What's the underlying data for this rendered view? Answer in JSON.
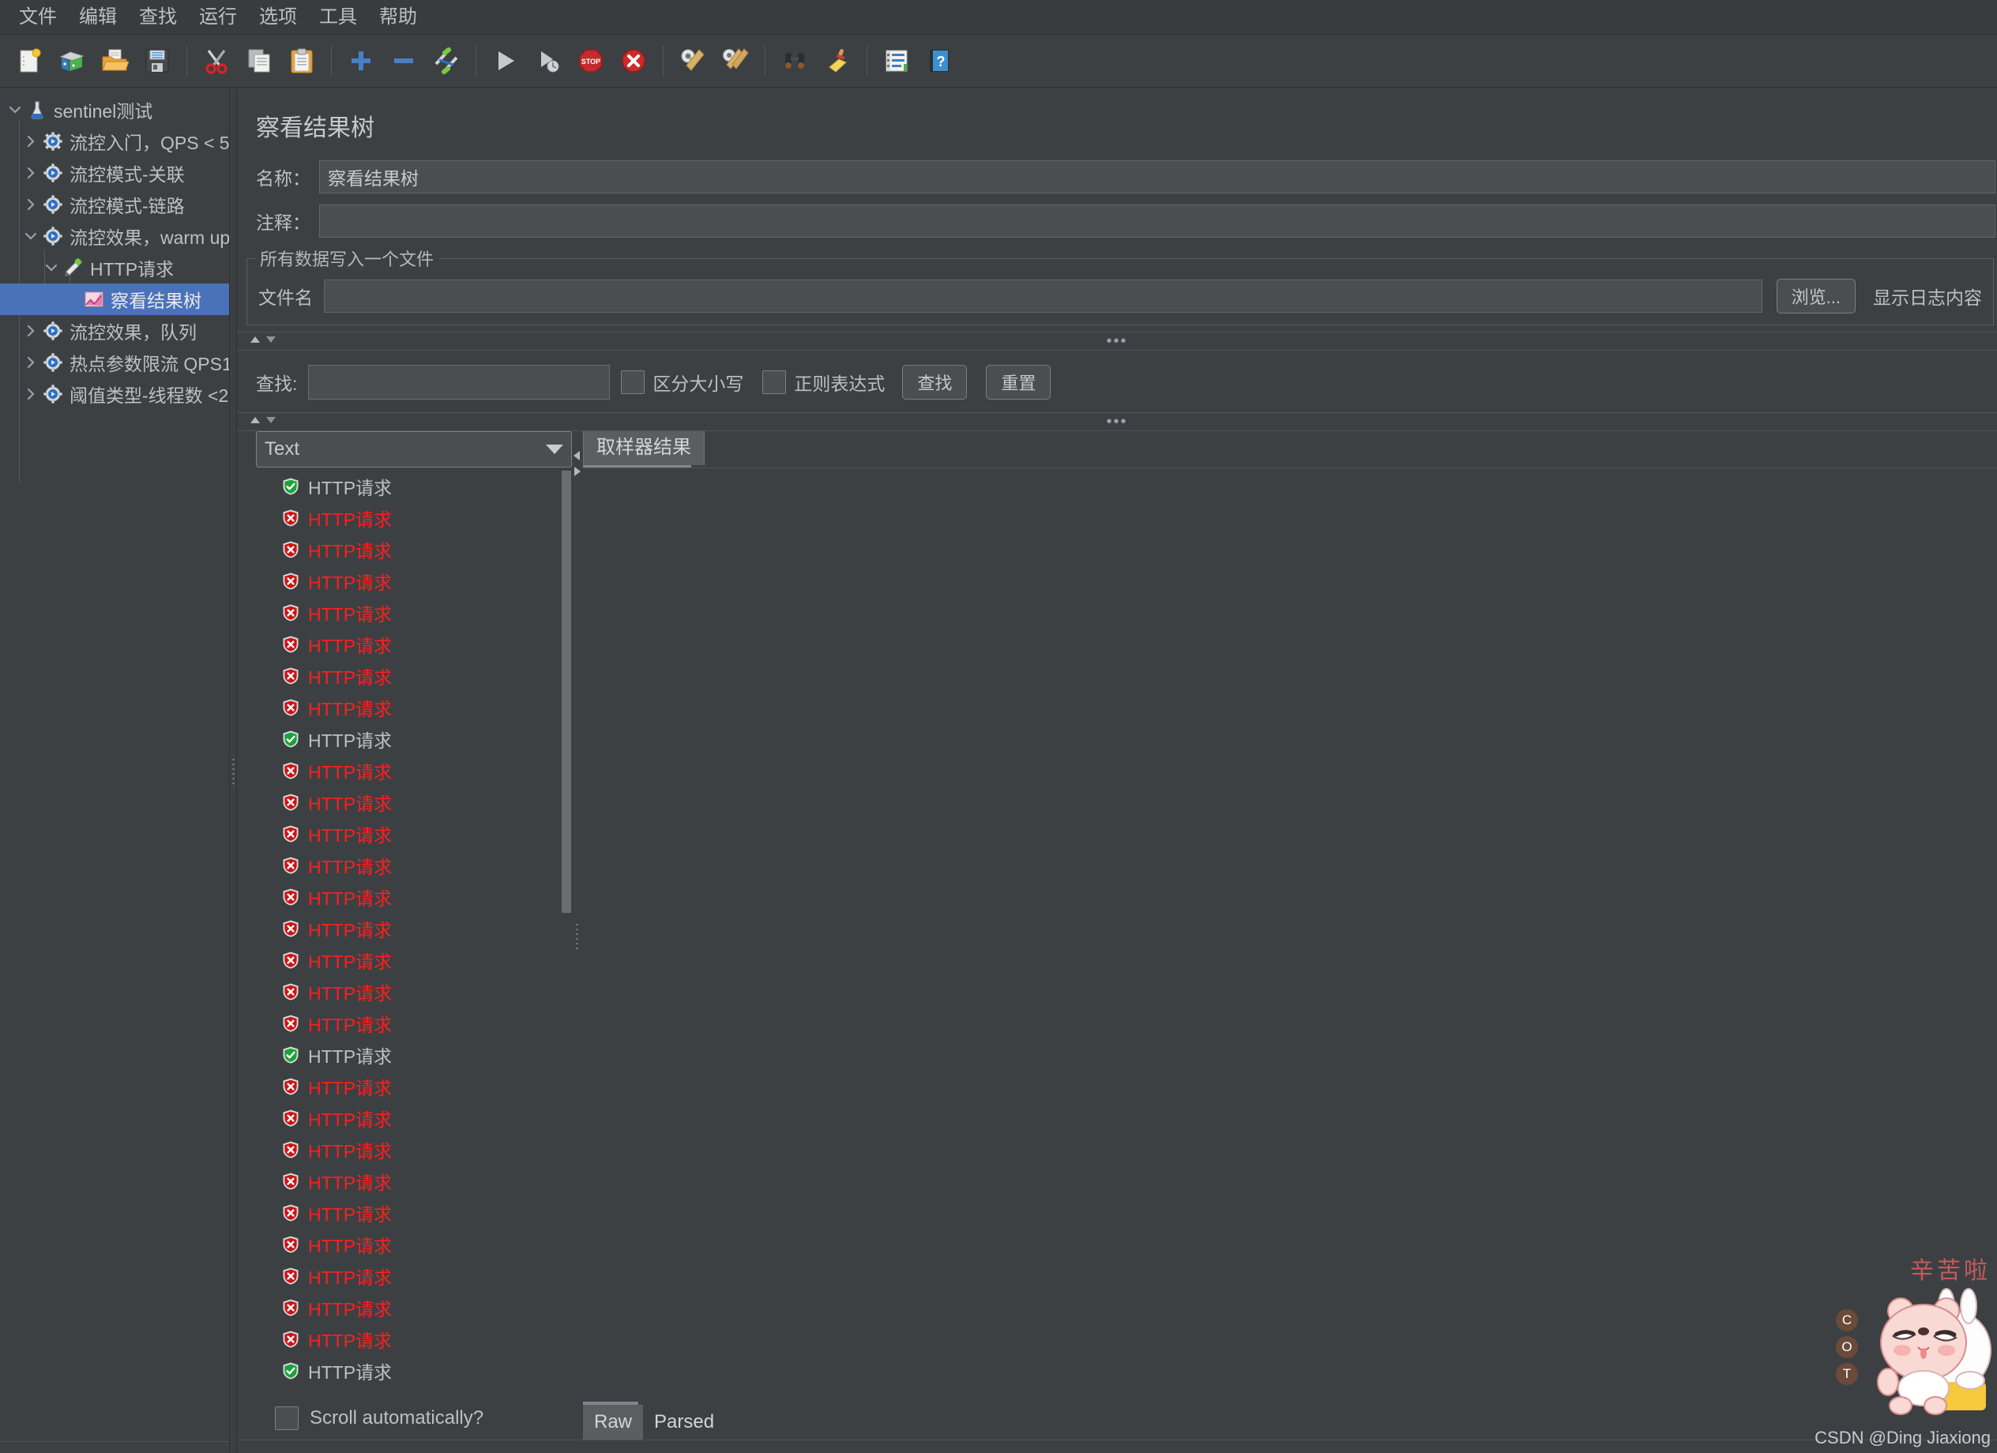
{
  "menubar": {
    "items": [
      {
        "label": "文件",
        "name": "menu-file"
      },
      {
        "label": "编辑",
        "name": "menu-edit"
      },
      {
        "label": "查找",
        "name": "menu-search"
      },
      {
        "label": "运行",
        "name": "menu-run"
      },
      {
        "label": "选项",
        "name": "menu-options"
      },
      {
        "label": "工具",
        "name": "menu-tools"
      },
      {
        "label": "帮助",
        "name": "menu-help"
      }
    ]
  },
  "toolbar": {
    "buttons": [
      {
        "icon": "new-document-icon",
        "title": "新建"
      },
      {
        "icon": "templates-icon",
        "title": "模板"
      },
      {
        "icon": "open-folder-icon",
        "title": "打开"
      },
      {
        "icon": "save-floppy-icon",
        "title": "保存"
      },
      {
        "sep": true
      },
      {
        "icon": "cut-scissors-icon",
        "title": "剪切"
      },
      {
        "icon": "copy-pages-icon",
        "title": "复制"
      },
      {
        "icon": "paste-clipboard-icon",
        "title": "粘贴"
      },
      {
        "sep": true
      },
      {
        "icon": "expand-plus-icon",
        "title": "展开"
      },
      {
        "icon": "collapse-minus-icon",
        "title": "收起"
      },
      {
        "icon": "toggle-pin-icon",
        "title": "切换"
      },
      {
        "sep": true
      },
      {
        "icon": "start-play-icon",
        "title": "启动"
      },
      {
        "icon": "start-no-timers-icon",
        "title": "无停顿启动"
      },
      {
        "icon": "stop-sign-icon",
        "title": "停止"
      },
      {
        "icon": "shutdown-x-icon",
        "title": "关闭"
      },
      {
        "sep": true
      },
      {
        "icon": "clear-gear-broom-icon",
        "title": "清除"
      },
      {
        "icon": "clear-all-broom-icon",
        "title": "清除全部"
      },
      {
        "sep": true
      },
      {
        "icon": "binoculars-search-icon",
        "title": "查找"
      },
      {
        "icon": "reset-broom-icon",
        "title": "重置查找"
      },
      {
        "sep": true
      },
      {
        "icon": "function-helper-icon",
        "title": "函数助手"
      },
      {
        "icon": "help-book-icon",
        "title": "帮助"
      }
    ]
  },
  "tree": {
    "nodes": [
      {
        "label": "sentinel测试",
        "icon": "flask-icon",
        "depth": 0,
        "twisty": "down",
        "selected": false
      },
      {
        "label": "流控入门，QPS < 5",
        "icon": "gear-thread-group-icon",
        "depth": 1,
        "twisty": "right",
        "selected": false
      },
      {
        "label": "流控模式-关联",
        "icon": "gear-thread-group-icon",
        "depth": 1,
        "twisty": "right",
        "selected": false
      },
      {
        "label": "流控模式-链路",
        "icon": "gear-thread-group-icon",
        "depth": 1,
        "twisty": "right",
        "selected": false
      },
      {
        "label": "流控效果，warm up",
        "icon": "gear-thread-group-icon",
        "depth": 1,
        "twisty": "down",
        "selected": false
      },
      {
        "label": "HTTP请求",
        "icon": "pipette-sampler-icon",
        "depth": 2,
        "twisty": "down",
        "selected": false
      },
      {
        "label": "察看结果树",
        "icon": "result-tree-icon",
        "depth": 3,
        "twisty": "none",
        "selected": true
      },
      {
        "label": "流控效果，队列",
        "icon": "gear-thread-group-icon",
        "depth": 1,
        "twisty": "right",
        "selected": false
      },
      {
        "label": "热点参数限流 QPS1",
        "icon": "gear-thread-group-icon",
        "depth": 1,
        "twisty": "right",
        "selected": false
      },
      {
        "label": "阈值类型-线程数 <2",
        "icon": "gear-thread-group-icon",
        "depth": 1,
        "twisty": "right",
        "selected": false
      }
    ]
  },
  "panel": {
    "title": "察看结果树",
    "name_label": "名称：",
    "name_value": "察看结果树",
    "comment_label": "注释：",
    "comment_value": "",
    "filegroup": {
      "legend": "所有数据写入一个文件",
      "filename_label": "文件名",
      "filename_value": "",
      "browse_button": "浏览...",
      "log_display_label": "显示日志内容"
    },
    "search": {
      "label": "查找:",
      "value": "",
      "case_sensitive_label": "区分大小写",
      "case_sensitive_checked": false,
      "regex_label": "正则表达式",
      "regex_checked": false,
      "find_button": "查找",
      "reset_button": "重置"
    },
    "renderer": {
      "selected": "Text"
    },
    "scroll_automatically": {
      "label": "Scroll automatically?",
      "checked": false
    },
    "sampler_tab": "取样器结果",
    "bottom_tabs": [
      {
        "label": "Raw",
        "active": true
      },
      {
        "label": "Parsed",
        "active": false
      }
    ]
  },
  "results": {
    "item_label": "HTTP请求",
    "items": [
      {
        "status": "ok"
      },
      {
        "status": "err"
      },
      {
        "status": "err"
      },
      {
        "status": "err"
      },
      {
        "status": "err"
      },
      {
        "status": "err"
      },
      {
        "status": "err"
      },
      {
        "status": "err"
      },
      {
        "status": "ok"
      },
      {
        "status": "err"
      },
      {
        "status": "err"
      },
      {
        "status": "err"
      },
      {
        "status": "err"
      },
      {
        "status": "err"
      },
      {
        "status": "err"
      },
      {
        "status": "err"
      },
      {
        "status": "err"
      },
      {
        "status": "err"
      },
      {
        "status": "ok"
      },
      {
        "status": "err"
      },
      {
        "status": "err"
      },
      {
        "status": "err"
      },
      {
        "status": "err"
      },
      {
        "status": "err"
      },
      {
        "status": "err"
      },
      {
        "status": "err"
      },
      {
        "status": "err"
      },
      {
        "status": "err"
      },
      {
        "status": "ok"
      }
    ]
  },
  "watermark": {
    "credit": "CSDN @Ding Jiaxiong",
    "cn_text": "辛苦啦",
    "badges": [
      "C",
      "O",
      "T"
    ]
  },
  "colors": {
    "bg": "#3c4043",
    "selection": "#4a72b8",
    "error_text": "#ff1e1e",
    "ok_text": "#bcc0c3"
  }
}
